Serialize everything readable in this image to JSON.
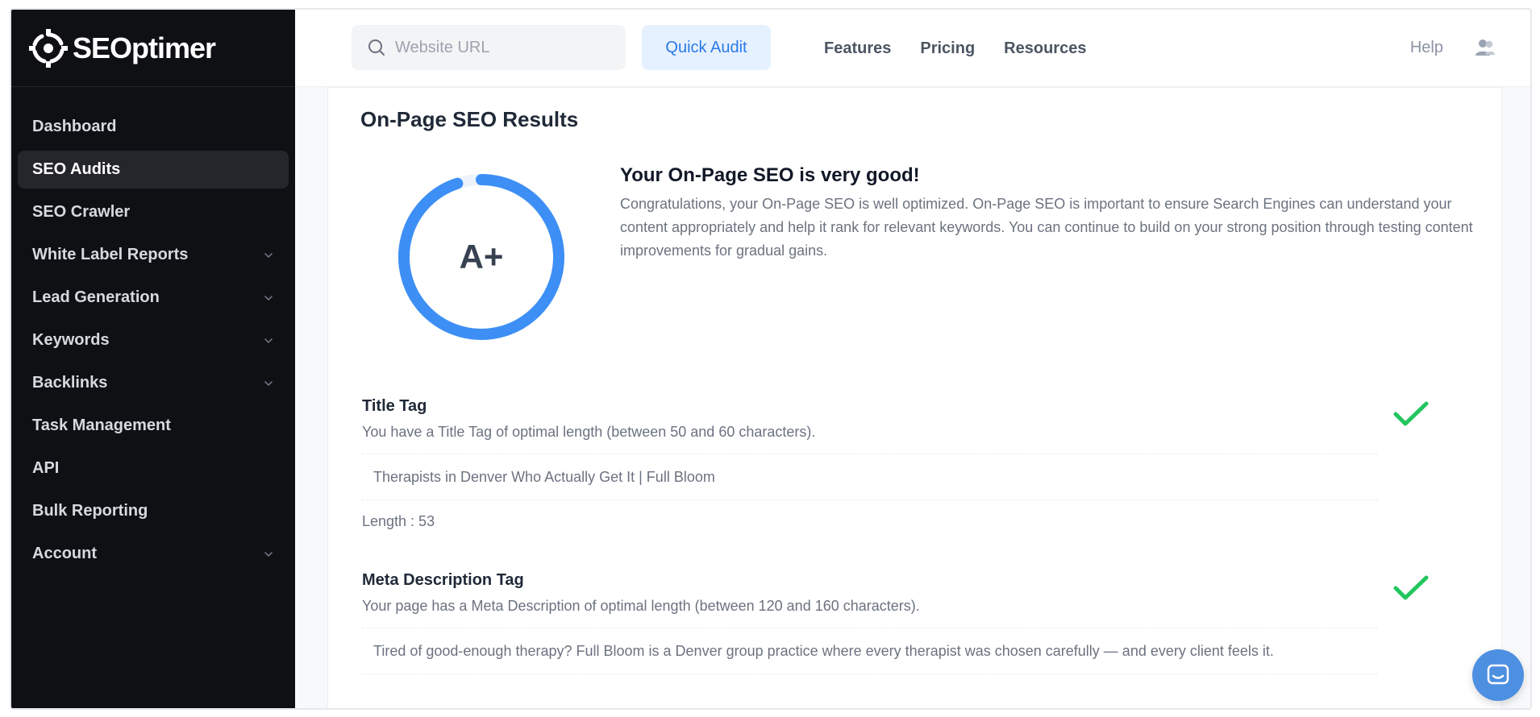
{
  "app": {
    "brand": "SEOptimer"
  },
  "sidebar": {
    "items": [
      {
        "label": "Dashboard",
        "has_chevron": false,
        "active": false
      },
      {
        "label": "SEO Audits",
        "has_chevron": false,
        "active": true
      },
      {
        "label": "SEO Crawler",
        "has_chevron": false,
        "active": false
      },
      {
        "label": "White Label Reports",
        "has_chevron": true,
        "active": false
      },
      {
        "label": "Lead Generation",
        "has_chevron": true,
        "active": false
      },
      {
        "label": "Keywords",
        "has_chevron": true,
        "active": false
      },
      {
        "label": "Backlinks",
        "has_chevron": true,
        "active": false
      },
      {
        "label": "Task Management",
        "has_chevron": false,
        "active": false
      },
      {
        "label": "API",
        "has_chevron": false,
        "active": false
      },
      {
        "label": "Bulk Reporting",
        "has_chevron": false,
        "active": false
      },
      {
        "label": "Account",
        "has_chevron": true,
        "active": false
      }
    ]
  },
  "topbar": {
    "search_placeholder": "Website URL",
    "quick_audit_label": "Quick Audit",
    "nav": [
      "Features",
      "Pricing",
      "Resources"
    ],
    "help_label": "Help"
  },
  "main": {
    "section_title": "On-Page SEO Results",
    "grade": "A+",
    "score_fraction": 0.95,
    "summary_title": "Your On-Page SEO is very good!",
    "summary_text": "Congratulations, your On-Page SEO is well optimized. On-Page SEO is important to ensure Search Engines can understand your content appropriately and help it rank for relevant keywords. You can continue to build on your strong position through testing content improvements for gradual gains.",
    "checks": [
      {
        "title": "Title Tag",
        "description": "You have a Title Tag of optimal length (between 50 and 60 characters).",
        "value": "Therapists in Denver Who Actually Get It | Full Bloom",
        "meta": "Length : 53",
        "status": "pass"
      },
      {
        "title": "Meta Description Tag",
        "description": "Your page has a Meta Description of optimal length (between 120 and 160 characters).",
        "value": "Tired of good-enough therapy? Full Bloom is a Denver group practice where every therapist was chosen carefully — and every client feels it.",
        "status": "pass"
      }
    ]
  },
  "colors": {
    "sidebar_bg": "#0f1014",
    "accent_blue": "#3d8ff5",
    "check_green": "#22c55e"
  },
  "icons": {
    "logo": "seoptimer-gear-logo-icon",
    "search": "search-icon",
    "user": "user-group-icon",
    "chevron": "chevron-down-icon",
    "check": "check-icon",
    "chat": "chat-icon"
  }
}
